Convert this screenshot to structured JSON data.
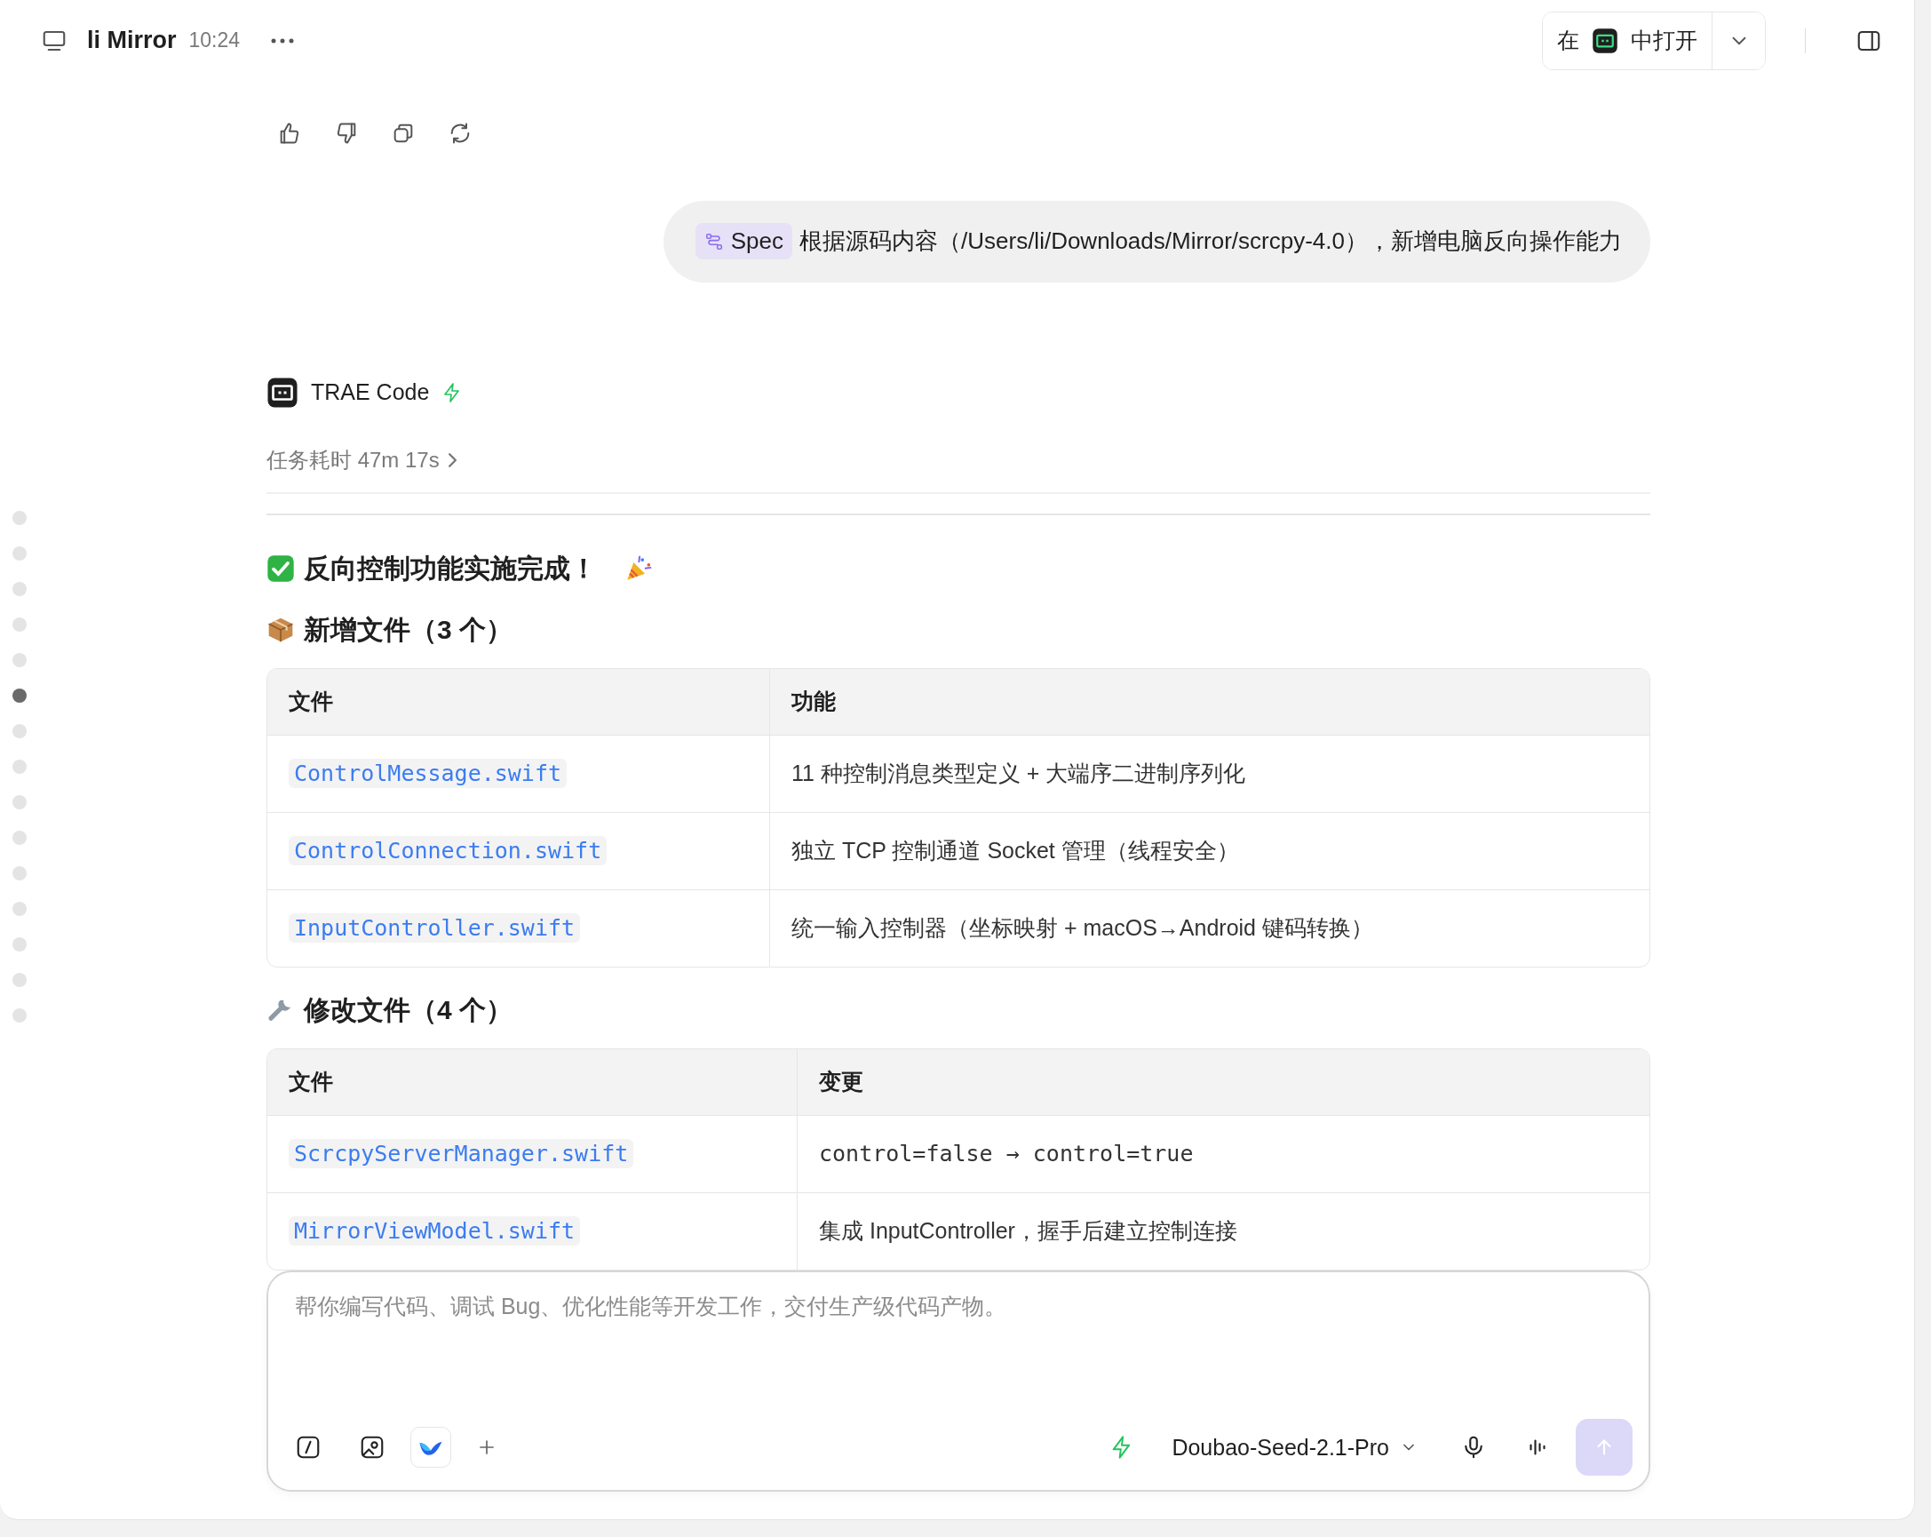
{
  "header": {
    "title": "li Mirror",
    "time": "10:24",
    "open_in": {
      "prefix": "在",
      "suffix": "中打开"
    }
  },
  "timeline": [
    {
      "selected": false
    },
    {
      "selected": false
    },
    {
      "selected": false
    },
    {
      "selected": false
    },
    {
      "selected": false
    },
    {
      "selected": true
    },
    {
      "selected": false
    },
    {
      "selected": false
    },
    {
      "selected": false
    },
    {
      "selected": false
    },
    {
      "selected": false
    },
    {
      "selected": false
    },
    {
      "selected": false
    },
    {
      "selected": false
    },
    {
      "selected": false
    }
  ],
  "user_message": {
    "tag": "Spec",
    "text": "根据源码内容（/Users/li/Downloads/Mirror/scrcpy-4.0），新增电脑反向操作能力"
  },
  "assistant": {
    "name": "TRAE Code",
    "duration": "任务耗时 47m 17s"
  },
  "summary": {
    "title": "反向控制功能实施完成！",
    "new_files": {
      "heading": "新增文件（3 个）",
      "columns": [
        "文件",
        "功能"
      ],
      "rows": [
        [
          {
            "kind": "code",
            "text": "ControlMessage.swift"
          },
          {
            "kind": "text",
            "text": "11 种控制消息类型定义 + 大端序二进制序列化"
          }
        ],
        [
          {
            "kind": "code",
            "text": "ControlConnection.swift"
          },
          {
            "kind": "text",
            "text": "独立 TCP 控制通道 Socket 管理（线程安全）"
          }
        ],
        [
          {
            "kind": "code",
            "text": "InputController.swift"
          },
          {
            "kind": "text",
            "text": "统一输入控制器（坐标映射 + macOS→Android 键码转换）"
          }
        ]
      ]
    },
    "modified_files": {
      "heading": "修改文件（4 个）",
      "columns": [
        "文件",
        "变更"
      ],
      "rows": [
        [
          {
            "kind": "code",
            "text": "ScrcpyServerManager.swift"
          },
          {
            "kind": "mono",
            "text": "control=false → control=true"
          }
        ],
        [
          {
            "kind": "code",
            "text": "MirrorViewModel.swift"
          },
          {
            "kind": "text",
            "text": "集成 InputController，握手后建立控制连接"
          }
        ]
      ]
    }
  },
  "composer": {
    "placeholder": "帮你编写代码、调试 Bug、优化性能等开发工作，交付生产级代码产物。",
    "model": "Doubao-Seed-2.1-Pro",
    "send_disabled": true
  }
}
